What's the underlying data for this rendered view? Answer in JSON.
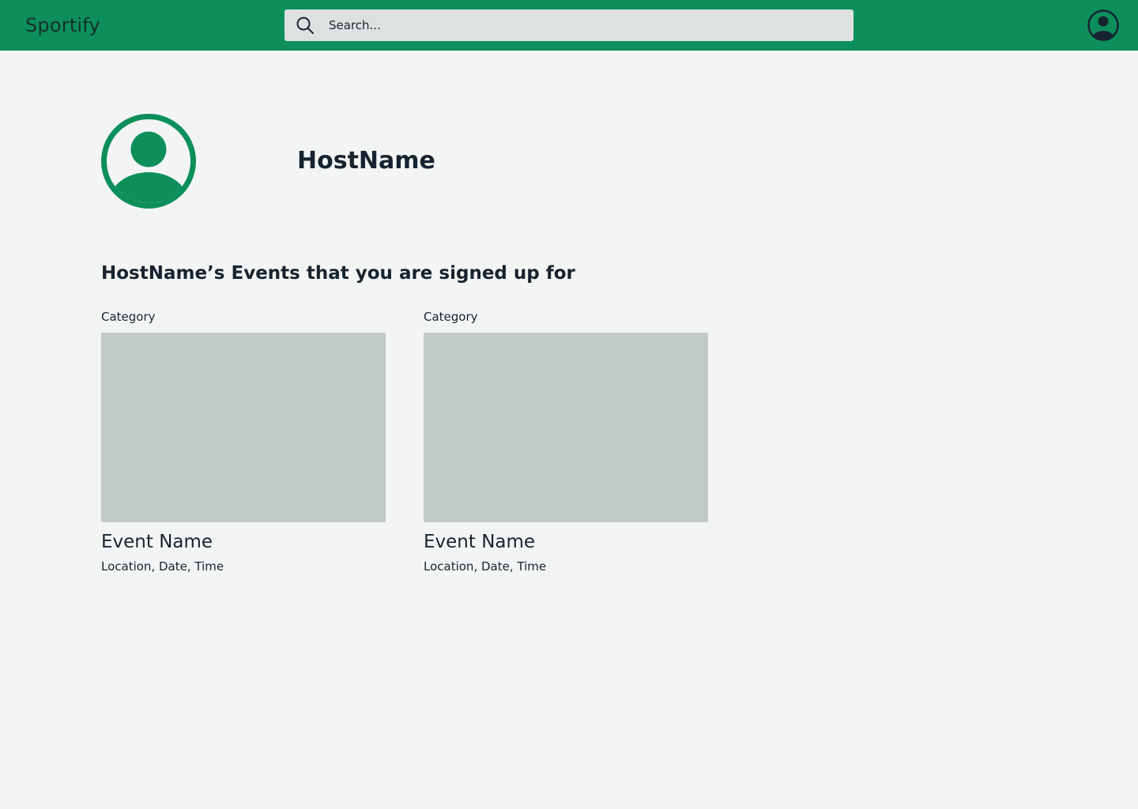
{
  "app": {
    "brand": "Sportify"
  },
  "search": {
    "placeholder": "Search...",
    "value": "",
    "icon": "search-icon"
  },
  "header": {
    "account_icon": "account-circle-icon"
  },
  "profile": {
    "name": "HostName",
    "avatar_icon": "user-avatar-icon"
  },
  "events_section": {
    "title": "HostName’s Events that you are signed up for",
    "events": [
      {
        "category": "Category",
        "name": "Event Name",
        "meta": "Location, Date, Time"
      },
      {
        "category": "Category",
        "name": "Event Name",
        "meta": "Location, Date, Time"
      }
    ]
  },
  "colors": {
    "brand_green": "#0c8f5b",
    "page_background": "#f3f5f4",
    "search_background": "#dde1e0",
    "image_placeholder": "#c2cac7",
    "text_dark": "#17232f"
  }
}
